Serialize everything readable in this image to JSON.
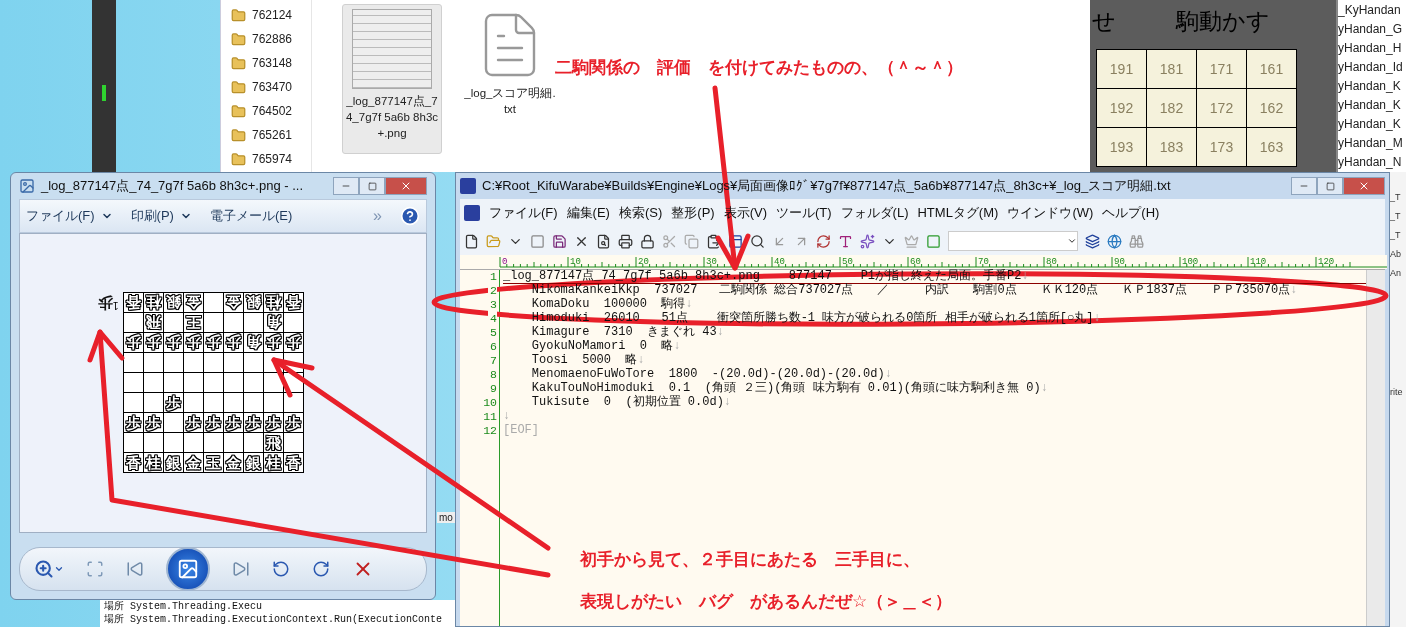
{
  "explorer": {
    "folders": [
      "762124",
      "762886",
      "763148",
      "763470",
      "764502",
      "765261",
      "765974"
    ],
    "files": [
      {
        "kind": "image",
        "name": "_log_877147点_74_7g7f 5a6b 8h3c+.png",
        "selected": true
      },
      {
        "kind": "text",
        "name": "_log_スコア明細.txt",
        "selected": false
      }
    ]
  },
  "dark_window": {
    "heading_1": "せ",
    "heading_2": "駒動かす",
    "grid": [
      [
        "191",
        "181",
        "171",
        "161"
      ],
      [
        "192",
        "182",
        "172",
        "162"
      ],
      [
        "193",
        "183",
        "173",
        "163"
      ]
    ]
  },
  "side_list": [
    "_KyHandan",
    "yHandan_G",
    "yHandan_H",
    "yHandan_Id",
    "yHandan_K",
    "yHandan_K",
    "yHandan_K",
    "yHandan_M",
    "yHandan_N"
  ],
  "side_strip": [
    "_T",
    "_T",
    "_T",
    "Ab",
    "An"
  ],
  "side_strip_fragment": "rite",
  "viewer": {
    "title": "_log_877147点_74_7g7f 5a6b 8h3c+.png - ...",
    "menu": [
      {
        "label": "ファイル(F)",
        "dropdown": true
      },
      {
        "label": "印刷(P)",
        "dropdown": true
      },
      {
        "label": "電子メール(E)",
        "dropdown": false
      }
    ],
    "overflow": "»",
    "hand": {
      "piece": "歩",
      "count": "1"
    },
    "board": [
      {
        "cells": [
          {
            "piece": "香",
            "enemy": true
          },
          {
            "piece": "桂",
            "enemy": true
          },
          {
            "piece": "銀",
            "enemy": true
          },
          {
            "piece": "金",
            "enemy": true
          },
          {},
          {
            "piece": "金",
            "enemy": true
          },
          {
            "piece": "銀",
            "enemy": true
          },
          {
            "piece": "桂",
            "enemy": true
          },
          {
            "piece": "香",
            "enemy": true
          }
        ]
      },
      {
        "cells": [
          {},
          {
            "piece": "飛",
            "enemy": true
          },
          {},
          {
            "piece": "王",
            "enemy": true
          },
          {},
          {},
          {},
          {
            "piece": "角",
            "enemy": true
          },
          {}
        ]
      },
      {
        "cells": [
          {
            "piece": "歩",
            "enemy": true
          },
          {
            "piece": "歩",
            "enemy": true
          },
          {
            "piece": "歩",
            "enemy": true
          },
          {
            "piece": "歩",
            "enemy": true
          },
          {
            "piece": "歩",
            "enemy": true
          },
          {
            "piece": "歩",
            "enemy": true
          },
          {
            "piece": "角",
            "enemy": true
          },
          {
            "piece": "歩",
            "enemy": true
          },
          {
            "piece": "歩",
            "enemy": true
          }
        ]
      },
      {
        "cells": [
          {},
          {},
          {},
          {},
          {},
          {},
          {},
          {},
          {}
        ]
      },
      {
        "cells": [
          {},
          {},
          {},
          {},
          {},
          {},
          {},
          {},
          {}
        ]
      },
      {
        "cells": [
          {},
          {},
          {
            "piece": "歩",
            "enemy": false
          },
          {},
          {},
          {},
          {},
          {},
          {}
        ]
      },
      {
        "cells": [
          {
            "piece": "歩",
            "enemy": false
          },
          {
            "piece": "歩",
            "enemy": false
          },
          {},
          {
            "piece": "歩",
            "enemy": false
          },
          {
            "piece": "歩",
            "enemy": false
          },
          {
            "piece": "歩",
            "enemy": false
          },
          {
            "piece": "歩",
            "enemy": false
          },
          {
            "piece": "歩",
            "enemy": false
          },
          {
            "piece": "歩",
            "enemy": false
          }
        ]
      },
      {
        "cells": [
          {},
          {},
          {},
          {},
          {},
          {},
          {},
          {
            "piece": "飛",
            "enemy": false
          },
          {}
        ]
      },
      {
        "cells": [
          {
            "piece": "香",
            "enemy": false
          },
          {
            "piece": "桂",
            "enemy": false
          },
          {
            "piece": "銀",
            "enemy": false
          },
          {
            "piece": "金",
            "enemy": false
          },
          {
            "piece": "玉",
            "enemy": false
          },
          {
            "piece": "金",
            "enemy": false
          },
          {
            "piece": "銀",
            "enemy": false
          },
          {
            "piece": "桂",
            "enemy": false
          },
          {
            "piece": "香",
            "enemy": false
          }
        ]
      }
    ]
  },
  "console_fragment": "mo",
  "console": [
    "場所 System.Threading.Execu",
    "場所 System.Threading.ExecutionContext.Run(ExecutionConte"
  ],
  "editor": {
    "title": "C:¥Root_KifuWarabe¥Builds¥Engine¥Logs¥局面画像ﾛｸﾞ¥7g7f¥877147点_5a6b¥877147点_8h3c+¥_log_スコア明細.txt",
    "menu": [
      "ファイル(F)",
      "編集(E)",
      "検索(S)",
      "整形(P)",
      "表示(V)",
      "ツール(T)",
      "フォルダ(L)",
      "HTMLタグ(M)",
      "ウインドウ(W)",
      "ヘルプ(H)"
    ],
    "ruler": [
      "0",
      "10",
      "20",
      "30",
      "40",
      "50",
      "60",
      "70",
      "80",
      "90",
      "100",
      "110",
      "120"
    ],
    "lines": [
      {
        "number": "1",
        "text": "_log_877147点_74_7g7f 5a6b 8h3c+.png    877147    P1が指し終えた局面。手番P2",
        "end": "↓",
        "current": true
      },
      {
        "number": "2",
        "text": "    NikomaKankeiKkp  737027   二駒関係 総合737027点　　／　　　内訳　　駒割0点　　ＫＫ120点　　ＫＰ1837点　　ＰＰ735070点",
        "end": "↓",
        "current": false
      },
      {
        "number": "3",
        "text": "    KomaDoku  100000  駒得",
        "end": "↓",
        "current": false
      },
      {
        "number": "4",
        "text": "    Himoduki  26010   51点    衝突箇所勝ち数-1 味方が破られる0箇所 相手が破られる1箇所[○丸]",
        "end": "↓",
        "current": false
      },
      {
        "number": "5",
        "text": "    Kimagure  7310  きまぐれ 43",
        "end": "↓",
        "current": false
      },
      {
        "number": "6",
        "text": "    GyokuNoMamori  0  略",
        "end": "↓",
        "current": false
      },
      {
        "number": "7",
        "text": "    Toosi  5000  略",
        "end": "↓",
        "current": false
      },
      {
        "number": "8",
        "text": "    MenomaenoFuWoTore  1800  -(20.0d)-(20.0d)-(20.0d)",
        "end": "↓",
        "current": false
      },
      {
        "number": "9",
        "text": "    KakuTouNoHimoduki  0.1  (角頭 ２三)(角頭 味方駒有 0.01)(角頭に味方駒利き無 0)",
        "end": "↓",
        "current": false
      },
      {
        "number": "10",
        "text": "    Tukisute  0  (初期位置 0.0d)",
        "end": "↓",
        "current": false
      },
      {
        "number": "11",
        "end": "↓",
        "current": false
      },
      {
        "number": "12",
        "text": "[EOF]",
        "current": false
      }
    ]
  },
  "annotations": [
    "二駒関係の　評価　を付けてみたものの、（＾～＾）",
    "初手から見て、２手目にあたる　三手目に、",
    "表現しがたい　バグ　があるんだぜ☆（＞＿＜）"
  ]
}
